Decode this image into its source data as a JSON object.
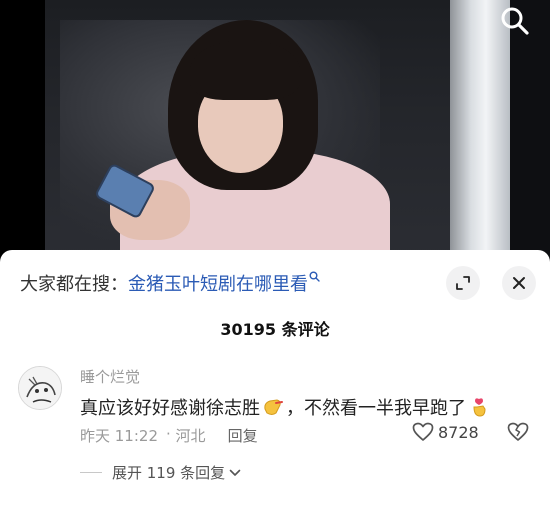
{
  "search_bar": {
    "prefix": "大家都在搜：",
    "query": "金猪玉叶短剧在哪里看"
  },
  "comments_header": {
    "count_label": "30195 条评论"
  },
  "comment": {
    "username": "睡个烂觉",
    "text_part1": "真应该好好感谢徐志胜",
    "text_part2": "，不然看一半我早跑了",
    "time": "昨天 11:22",
    "location": "河北",
    "reply_label": "回复",
    "like_count": "8728"
  },
  "replies": {
    "expand_label": "展开 119 条回复"
  },
  "colors": {
    "link": "#2b5bb5",
    "sheet_bg": "#ffffff",
    "muted_text": "#9a9a9a"
  },
  "icons": [
    "search-icon",
    "expand-icon",
    "close-icon",
    "link-search-icon",
    "heart-icon",
    "broken-heart-icon",
    "chevron-down-icon",
    "clap-emoji",
    "finger-heart-emoji"
  ]
}
